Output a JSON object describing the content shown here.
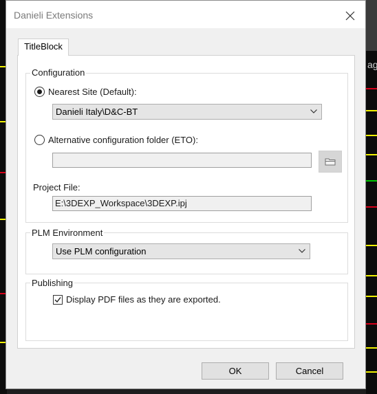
{
  "dialog": {
    "title": "Danieli Extensions",
    "tabs": [
      {
        "label": "TitleBlock"
      }
    ]
  },
  "configuration": {
    "group_label": "Configuration",
    "nearest_site": {
      "label": "Nearest Site (Default):",
      "selected": true,
      "value": "Danieli Italy\\D&C-BT"
    },
    "alternative": {
      "label": "Alternative configuration folder (ETO):",
      "selected": false,
      "value": ""
    },
    "project_file": {
      "label": "Project File:",
      "value": "E:\\3DEXP_Workspace\\3DEXP.ipj"
    }
  },
  "plm": {
    "group_label": "PLM Environment",
    "value": "Use PLM configuration"
  },
  "publishing": {
    "group_label": "Publishing",
    "display_pdf": {
      "label": "Display PDF files as they are exported.",
      "checked": true
    }
  },
  "buttons": {
    "ok": "OK",
    "cancel": "Cancel"
  },
  "colors": {
    "cad_yellow": "#f2f200",
    "cad_red": "#d8001a",
    "cad_green": "#00c800"
  },
  "icons": {
    "close": "close-icon",
    "dropdown": "chevron-down-icon",
    "browse": "folder-icon",
    "check": "checkmark-icon"
  }
}
